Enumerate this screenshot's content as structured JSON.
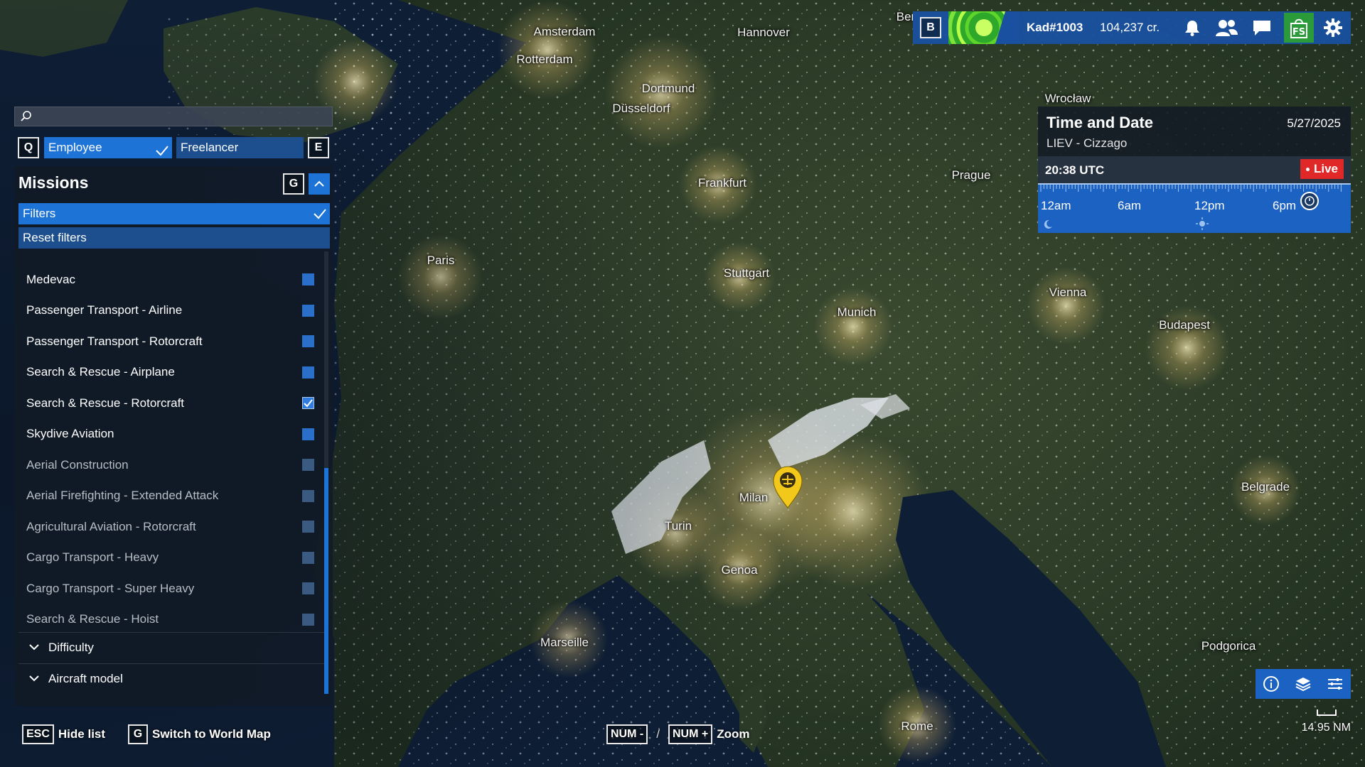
{
  "map": {
    "cities": [
      {
        "name": "Amsterdam",
        "id": "amsterdam"
      },
      {
        "name": "Hannover",
        "id": "hannover"
      },
      {
        "name": "Ber",
        "id": "berlin"
      },
      {
        "name": "Rotterdam",
        "id": "rotterdam"
      },
      {
        "name": "Dortmund",
        "id": "dortmund"
      },
      {
        "name": "Düsseldorf",
        "id": "dusseldorf"
      },
      {
        "name": "Wrocław",
        "id": "wroclaw"
      },
      {
        "name": "Frankfurt",
        "id": "frankfurt"
      },
      {
        "name": "Prague",
        "id": "prague"
      },
      {
        "name": "Paris",
        "id": "paris"
      },
      {
        "name": "Stuttgart",
        "id": "stuttgart"
      },
      {
        "name": "Munich",
        "id": "munich"
      },
      {
        "name": "Vienna",
        "id": "vienna"
      },
      {
        "name": "Budapest",
        "id": "budapest"
      },
      {
        "name": "Milan",
        "id": "milan"
      },
      {
        "name": "Turin",
        "id": "turin"
      },
      {
        "name": "Genoa",
        "id": "genoa"
      },
      {
        "name": "Belgrade",
        "id": "belgrade"
      },
      {
        "name": "Marseille",
        "id": "marseille"
      },
      {
        "name": "Podgorica",
        "id": "podgorica"
      },
      {
        "name": "Rome",
        "id": "rome"
      }
    ],
    "marker_icon": "location-pin-icon"
  },
  "search": {
    "placeholder": "",
    "value": "",
    "icon": "search-icon"
  },
  "mode_tabs": {
    "prev_key": "Q",
    "next_key": "E",
    "employee": "Employee",
    "freelancer": "Freelancer"
  },
  "missions": {
    "title": "Missions",
    "toggle_key": "G",
    "filters_label": "Filters",
    "reset_label": "Reset filters",
    "items": [
      {
        "label": "Medevac",
        "checked": false,
        "dim": false
      },
      {
        "label": "Passenger Transport - Airline",
        "checked": false,
        "dim": false
      },
      {
        "label": "Passenger Transport - Rotorcraft",
        "checked": false,
        "dim": false
      },
      {
        "label": "Search & Rescue - Airplane",
        "checked": false,
        "dim": false
      },
      {
        "label": "Search & Rescue - Rotorcraft",
        "checked": true,
        "dim": false
      },
      {
        "label": "Skydive Aviation",
        "checked": false,
        "dim": false
      },
      {
        "label": "Aerial Construction",
        "checked": false,
        "dim": true
      },
      {
        "label": "Aerial Firefighting - Extended Attack",
        "checked": false,
        "dim": true
      },
      {
        "label": "Agricultural Aviation - Rotorcraft",
        "checked": false,
        "dim": true
      },
      {
        "label": "Cargo Transport - Heavy",
        "checked": false,
        "dim": true
      },
      {
        "label": "Cargo Transport - Super Heavy",
        "checked": false,
        "dim": true
      },
      {
        "label": "Search & Rescue - Hoist",
        "checked": false,
        "dim": true
      }
    ],
    "sections": {
      "difficulty": "Difficulty",
      "aircraft": "Aircraft model"
    }
  },
  "hints": {
    "hide_key": "ESC",
    "hide_label": "Hide list",
    "switch_key": "G",
    "switch_label": "Switch to World Map",
    "zoom_out_key": "NUM -",
    "zoom_sep": "/",
    "zoom_in_key": "NUM +",
    "zoom_label": "Zoom"
  },
  "topbar": {
    "key": "B",
    "username": "Kad#1003",
    "credits": "104,237 cr."
  },
  "time_panel": {
    "title": "Time and Date",
    "date": "5/27/2025",
    "location": "LIEV - Cizzago",
    "utc": "20:38 UTC",
    "live": "Live",
    "timeline_labels": [
      "12am",
      "6am",
      "12pm",
      "6pm"
    ],
    "progress": 0.86
  },
  "map_controls": {
    "scale": "14.95 NM"
  },
  "colors": {
    "accent": "#1e73d6",
    "live": "#e02828",
    "shop": "#2b9a3a",
    "marker": "#f2c81b"
  }
}
